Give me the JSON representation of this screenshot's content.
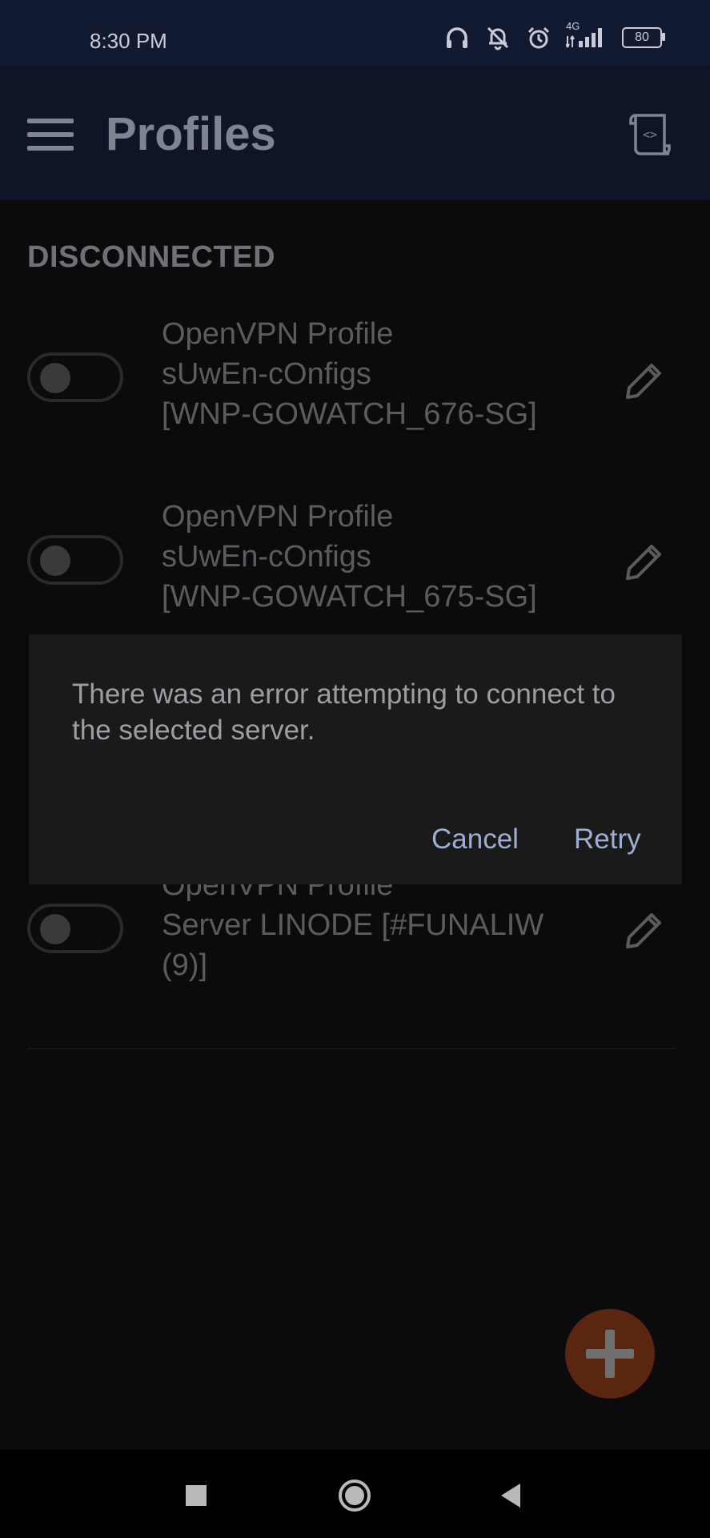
{
  "status_bar": {
    "time": "8:30 PM",
    "network": "4G",
    "battery": "80",
    "icons": [
      "headphones-icon",
      "mute-icon",
      "alarm-icon",
      "signal-icon",
      "battery-icon"
    ]
  },
  "app_bar": {
    "title": "Profiles",
    "menu_icon": "hamburger-icon",
    "import_icon": "import-script-icon"
  },
  "section": {
    "title": "DISCONNECTED"
  },
  "profiles": [
    {
      "type": "OpenVPN Profile",
      "name_line1": "sUwEn-cOnfigs",
      "name_line2": "[WNP-GOWATCH_676-SG]",
      "enabled": false
    },
    {
      "type": "OpenVPN Profile",
      "name_line1": "sUwEn-cOnfigs",
      "name_line2": "[WNP-GOWATCH_675-SG]",
      "enabled": false
    },
    {
      "type": "OpenVPN Profile",
      "name_line1": "Server LINODE [#FUNALIW",
      "name_line2": "(9)]",
      "enabled": false
    }
  ],
  "dialog": {
    "message": "There was an error attempting to connect to the selected server.",
    "cancel_label": "Cancel",
    "retry_label": "Retry"
  },
  "fab": {
    "icon": "plus-icon"
  },
  "nav_bar": {
    "icons": [
      "recents-square-icon",
      "home-circle-icon",
      "back-triangle-icon"
    ]
  },
  "colors": {
    "status_bar_bg": "#111a30",
    "app_bar_bg": "#0e1526",
    "background": "#0b0b0c",
    "dialog_bg": "#1a1a1b",
    "dialog_button": "#9eaed2",
    "fab_bg": "#5a2610"
  }
}
